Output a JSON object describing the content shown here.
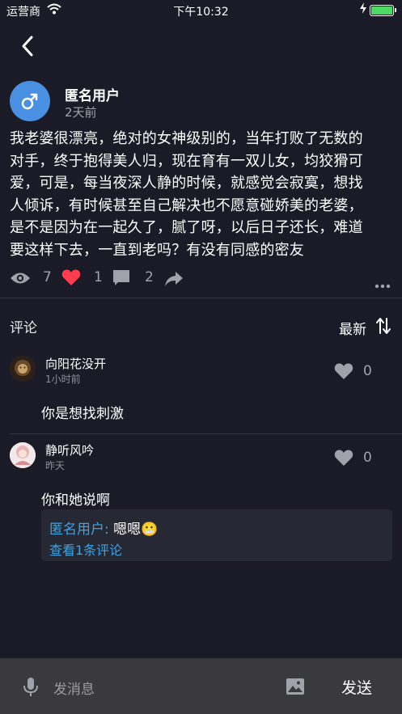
{
  "status_bar": {
    "carrier": "运营商",
    "time": "下午10:32"
  },
  "post": {
    "author": "匿名用户",
    "time": "2天前",
    "lines": [
      "我老婆很漂亮，绝对的女神级别的，当年打败了无数的",
      "对手，终于抱得美人归，现在育有一双儿女，均狡猾可",
      "爱，可是，每当夜深人静的时候，就感觉会寂寞，想找",
      "人倾诉，有时候甚至自己解决也不愿意碰娇美的老婆，",
      "是不是因为在一起久了，腻了呀，以后日子还长，难道",
      "要这样下去，一直到老吗？有没有同感的密友"
    ],
    "stats": {
      "views": "7",
      "likes": "1",
      "comments": "2"
    },
    "colors": {
      "avatar_bg": "#4a90e2",
      "like": "#ff3b4e"
    }
  },
  "comments_section": {
    "title": "评论",
    "sort_label": "最新",
    "items": [
      {
        "author": "向阳花没开",
        "time": "1小时前",
        "text": "你是想找刺激",
        "likes": "0"
      },
      {
        "author": "静听风吟",
        "time": "昨天",
        "text": "你和她说啊",
        "likes": "0",
        "reply": {
          "author": "匿名用户:",
          "text": " 嗯嗯😬",
          "view_more": "查看1条评论"
        }
      }
    ]
  },
  "bottom_bar": {
    "placeholder": "发消息",
    "send_label": "发送"
  }
}
